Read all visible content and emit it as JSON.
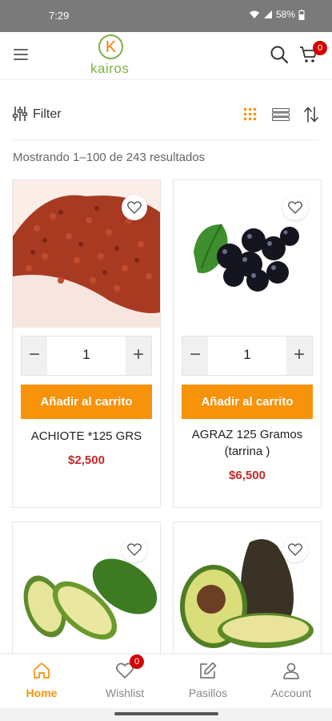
{
  "status_bar": {
    "time": "7:29",
    "battery": "58%"
  },
  "header": {
    "logo_text": "kairos",
    "logo_letter": "K",
    "cart_count": "0"
  },
  "filter_bar": {
    "filter_label": "Filter"
  },
  "results": {
    "text": "Mostrando 1–100 de 243 resultados"
  },
  "products": [
    {
      "name": "ACHIOTE *125 GRS",
      "price": "$2,500",
      "quantity": "1",
      "add_label": "Añadir al carrito"
    },
    {
      "name": "AGRAZ 125 Gramos (tarrina )",
      "price": "$6,500",
      "quantity": "1",
      "add_label": "Añadir al carrito"
    },
    {
      "name": "",
      "price": ""
    },
    {
      "name": "",
      "price": ""
    }
  ],
  "bottom_nav": {
    "items": [
      {
        "label": "Home",
        "icon": "home-icon",
        "active": true
      },
      {
        "label": "Wishlist",
        "icon": "heart-icon",
        "badge": "0"
      },
      {
        "label": "Pasillos",
        "icon": "edit-icon"
      },
      {
        "label": "Account",
        "icon": "user-icon"
      }
    ]
  },
  "colors": {
    "accent": "#f7920b",
    "price": "#c62828",
    "badge": "#d50000",
    "brand_green": "#7cb342"
  }
}
